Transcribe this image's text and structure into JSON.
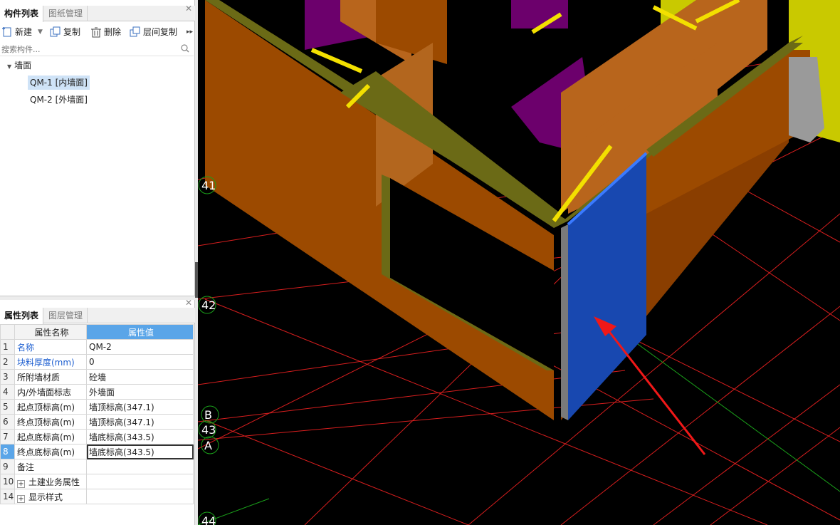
{
  "component_panel": {
    "tabs": [
      {
        "label": "构件列表",
        "active": true
      },
      {
        "label": "图纸管理",
        "active": false
      }
    ],
    "toolbar": [
      {
        "label": "新建",
        "icon": "new-icon"
      },
      {
        "label": "复制",
        "icon": "copy-icon"
      },
      {
        "label": "删除",
        "icon": "delete-icon"
      },
      {
        "label": "层间复制",
        "icon": "floor-copy-icon"
      }
    ],
    "search_placeholder": "搜索构件...",
    "tree": {
      "group": "墙面",
      "items": [
        {
          "label": "QM-1 [内墙面]",
          "selected": true
        },
        {
          "label": "QM-2 [外墙面]",
          "selected": false
        }
      ]
    }
  },
  "property_panel": {
    "tabs": [
      {
        "label": "属性列表",
        "active": true
      },
      {
        "label": "图层管理",
        "active": false
      }
    ],
    "headers": {
      "name": "属性名称",
      "value": "属性值"
    },
    "rows": [
      {
        "idx": "1",
        "name": "名称",
        "value": "QM-2",
        "link": true
      },
      {
        "idx": "2",
        "name": "块料厚度(mm)",
        "value": "0",
        "link": true
      },
      {
        "idx": "3",
        "name": "所附墙材质",
        "value": "砼墙",
        "link": false
      },
      {
        "idx": "4",
        "name": "内/外墙面标志",
        "value": "外墙面",
        "link": false
      },
      {
        "idx": "5",
        "name": "起点顶标高(m)",
        "value": "墙顶标高(347.1)",
        "link": false
      },
      {
        "idx": "6",
        "name": "终点顶标高(m)",
        "value": "墙顶标高(347.1)",
        "link": false
      },
      {
        "idx": "7",
        "name": "起点底标高(m)",
        "value": "墙底标高(343.5)",
        "link": false
      },
      {
        "idx": "8",
        "name": "终点底标高(m)",
        "value": "墙底标高(343.5)",
        "link": false,
        "active": true
      },
      {
        "idx": "9",
        "name": "备注",
        "value": "",
        "link": false
      },
      {
        "idx": "10",
        "name": "土建业务属性",
        "value": "",
        "link": false,
        "expandable": true
      },
      {
        "idx": "14",
        "name": "显示样式",
        "value": "",
        "link": false,
        "expandable": true
      }
    ]
  },
  "viewport": {
    "axis_labels": [
      "41",
      "42",
      "B",
      "43",
      "A",
      "44"
    ],
    "colors": {
      "background": "#000000",
      "grid_line": "#d81e1e",
      "wall": "#9c4a00",
      "wall_face": "#b8651c",
      "wall_top": "#6b6a16",
      "outer_wall_surface": "#1848b0",
      "highlight_yellow": "#f3e000",
      "purple_floor": "#6c006c",
      "arrow": "#f01818"
    }
  }
}
